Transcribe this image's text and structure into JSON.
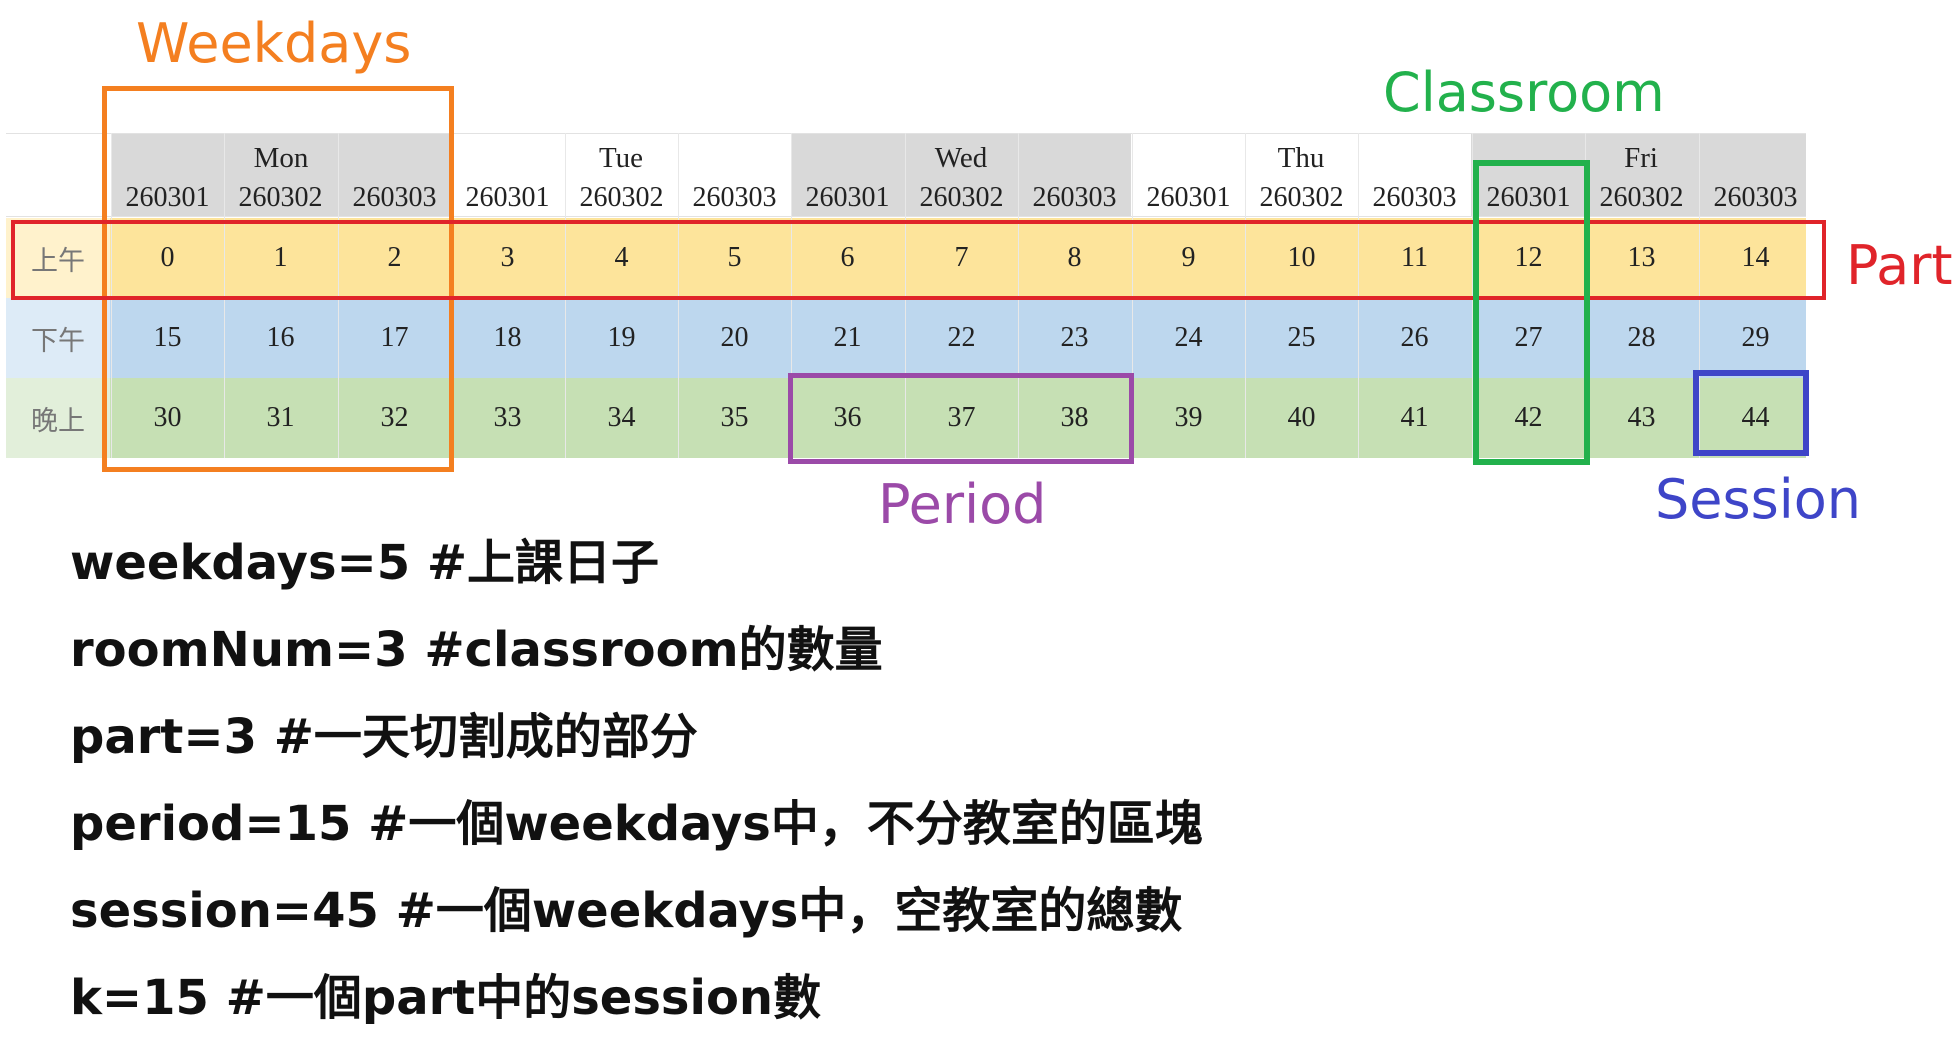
{
  "annotations": {
    "weekdays": "Weekdays",
    "classroom": "Classroom",
    "part": "Part",
    "period": "Period",
    "session": "Session"
  },
  "colors": {
    "weekdays": "#f47f20",
    "classroom": "#22b14c",
    "part": "#e0242a",
    "period": "#9b4aa8",
    "session": "#3e45c8",
    "row_morning": "#fde49b",
    "row_afternoon": "#bdd7ee",
    "row_evening": "#c6e0b4",
    "header_gray": "#d9d9d9"
  },
  "table": {
    "days": [
      "Mon",
      "Tue",
      "Wed",
      "Thu",
      "Fri"
    ],
    "rooms": [
      "260301",
      "260302",
      "260303"
    ],
    "row_labels": [
      "上午",
      "下午",
      "晚上"
    ],
    "cells": [
      [
        "0",
        "1",
        "2",
        "3",
        "4",
        "5",
        "6",
        "7",
        "8",
        "9",
        "10",
        "11",
        "12",
        "13",
        "14"
      ],
      [
        "15",
        "16",
        "17",
        "18",
        "19",
        "20",
        "21",
        "22",
        "23",
        "24",
        "25",
        "26",
        "27",
        "28",
        "29"
      ],
      [
        "30",
        "31",
        "32",
        "33",
        "34",
        "35",
        "36",
        "37",
        "38",
        "39",
        "40",
        "41",
        "42",
        "43",
        "44"
      ]
    ]
  },
  "notes": [
    "weekdays=5 #上課日子",
    "roomNum=3 #classroom的數量",
    "part=3 #一天切割成的部分",
    "period=15 #一個weekdays中，不分教室的區塊",
    "session=45 #一個weekdays中，空教室的總數",
    "k=15 #一個part中的session數"
  ]
}
